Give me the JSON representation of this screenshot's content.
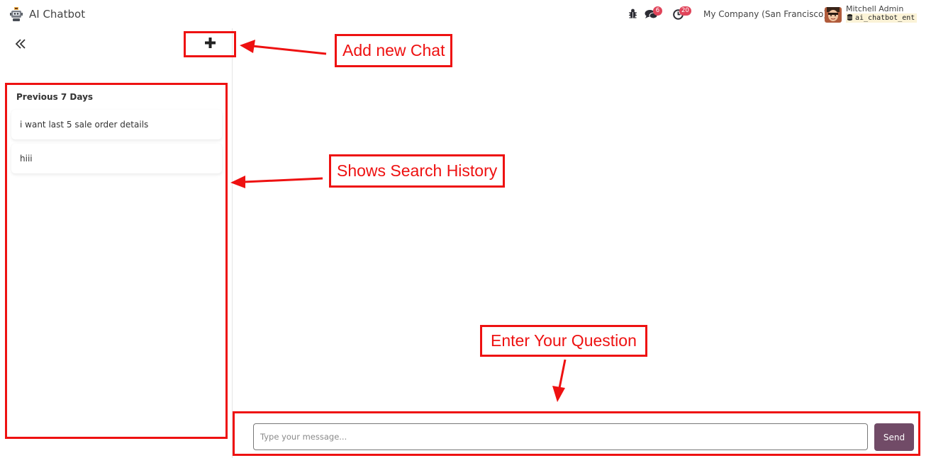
{
  "app": {
    "title": "AI Chatbot",
    "logo_icon": "robot-icon"
  },
  "navbar": {
    "icons": [
      "bug-icon",
      "chat-bubbles-icon",
      "clock-icon"
    ],
    "messages_badge": "6",
    "activities_badge": "20",
    "company": "My Company (San Francisco)",
    "user_name": "Mitchell Admin",
    "database": "ai_chatbot_ent"
  },
  "sidebar": {
    "collapse_icon": "double-chevron-left-icon",
    "new_chat_icon": "plus-icon",
    "history_heading": "Previous 7 Days",
    "history_items": [
      {
        "label": "i want last 5 sale order details"
      },
      {
        "label": "hiii"
      }
    ]
  },
  "chat": {
    "input_value": "",
    "input_placeholder": "Type your message...",
    "send_label": "Send"
  },
  "annotations": {
    "color": "#ee1111",
    "add_chat": "Add new Chat",
    "history": "Shows Search History",
    "question": "Enter Your Question"
  },
  "colors": {
    "send_button": "#714b67",
    "badge": "#e0445a"
  }
}
